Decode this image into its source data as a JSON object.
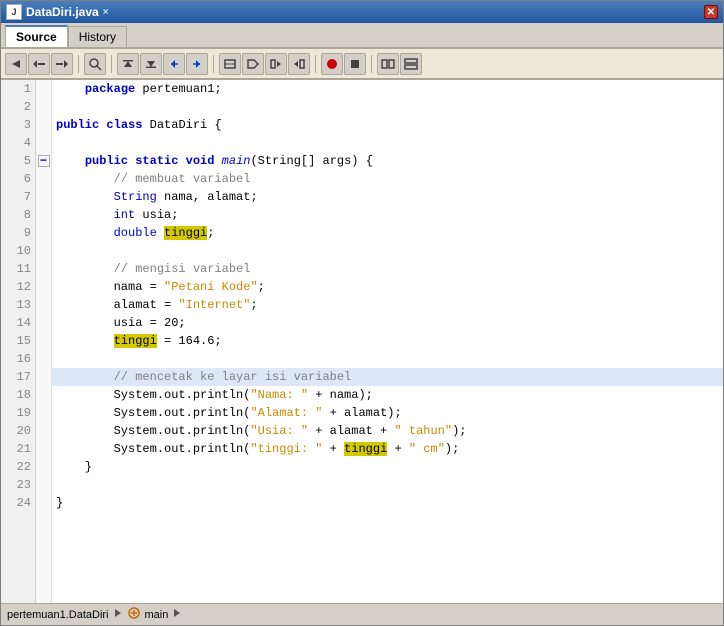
{
  "window": {
    "title": "DataDiri.java",
    "close_icon": "✕"
  },
  "tabs": {
    "source_label": "Source",
    "history_label": "History"
  },
  "toolbar": {
    "buttons": [
      "⬅",
      "⬅",
      "⬅",
      "🔍",
      "⬅",
      "➡",
      "⬅",
      "➡",
      "⬅",
      "➡",
      "⬅",
      "⬅",
      "⬅",
      "⬅",
      "⬅",
      "⬅",
      "⬅",
      "🔴",
      "⬛",
      "📊",
      "📊"
    ]
  },
  "code": {
    "lines": [
      {
        "num": 1,
        "content": "    package pertemuan1;",
        "type": "normal"
      },
      {
        "num": 2,
        "content": "",
        "type": "normal"
      },
      {
        "num": 3,
        "content": "public class DataDiri {",
        "type": "class"
      },
      {
        "num": 4,
        "content": "",
        "type": "normal"
      },
      {
        "num": 5,
        "content": "    public static void main(String[] args) {",
        "type": "method_sig",
        "fold": true
      },
      {
        "num": 6,
        "content": "        // membuat variabel",
        "type": "comment"
      },
      {
        "num": 7,
        "content": "        String nama, alamat;",
        "type": "normal"
      },
      {
        "num": 8,
        "content": "        int usia;",
        "type": "normal"
      },
      {
        "num": 9,
        "content": "        double tinggi;",
        "type": "normal"
      },
      {
        "num": 10,
        "content": "",
        "type": "normal"
      },
      {
        "num": 11,
        "content": "        // mengisi variabel",
        "type": "comment"
      },
      {
        "num": 12,
        "content": "        nama = \"Petani Kode\";",
        "type": "normal"
      },
      {
        "num": 13,
        "content": "        alamat = \"Internet\";",
        "type": "normal"
      },
      {
        "num": 14,
        "content": "        usia = 20;",
        "type": "normal"
      },
      {
        "num": 15,
        "content": "        tinggi = 164.6;",
        "type": "normal"
      },
      {
        "num": 16,
        "content": "",
        "type": "normal"
      },
      {
        "num": 17,
        "content": "        // mencetak ke layar isi variabel",
        "type": "comment",
        "highlighted": true
      },
      {
        "num": 18,
        "content": "        System.out.println(\"Nama: \" + nama);",
        "type": "normal"
      },
      {
        "num": 19,
        "content": "        System.out.println(\"Alamat: \" + alamat);",
        "type": "normal"
      },
      {
        "num": 20,
        "content": "        System.out.println(\"Usia: \" + alamat + \" tahun\");",
        "type": "normal"
      },
      {
        "num": 21,
        "content": "        System.out.println(\"tinggi: \" + tinggi + \" cm\");",
        "type": "normal"
      },
      {
        "num": 22,
        "content": "    }",
        "type": "normal"
      },
      {
        "num": 23,
        "content": "",
        "type": "normal"
      },
      {
        "num": 24,
        "content": "}",
        "type": "normal"
      }
    ]
  },
  "statusbar": {
    "package": "pertemuan1.DataDiri",
    "method": "main",
    "arrow": "›"
  }
}
